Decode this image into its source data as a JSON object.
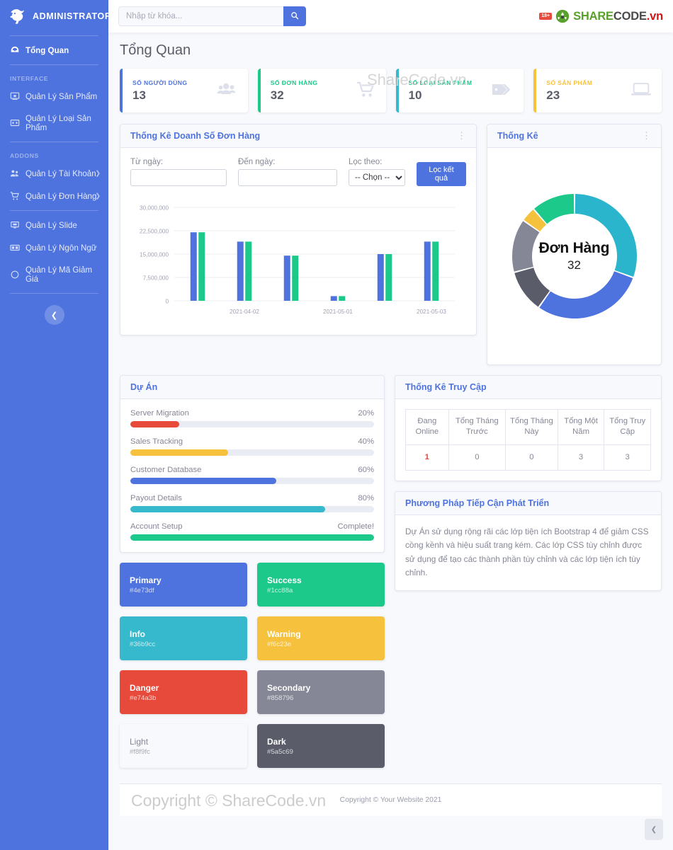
{
  "brand": {
    "title": "ADMINISTRATOR"
  },
  "sidebar": {
    "items": [
      {
        "label": "Tổng Quan",
        "icon": "dashboard-icon",
        "active": true
      }
    ],
    "sections": [
      {
        "heading": "INTERFACE",
        "items": [
          {
            "label": "Quản Lý Sản Phẩm",
            "icon": "product-icon",
            "caret": false
          },
          {
            "label": "Quản Lý Loại Sản Phẩm",
            "icon": "category-icon",
            "caret": false
          }
        ]
      },
      {
        "heading": "ADDONS",
        "items": [
          {
            "label": "Quản Lý Tài Khoản",
            "icon": "users-icon",
            "caret": true
          },
          {
            "label": "Quản Lý Đơn Hàng",
            "icon": "cart-icon",
            "caret": true
          }
        ]
      },
      {
        "heading": "",
        "items": [
          {
            "label": "Quản Lý Slide",
            "icon": "slide-icon",
            "caret": false
          },
          {
            "label": "Quản Lý Ngôn Ngữ",
            "icon": "language-icon",
            "caret": false
          },
          {
            "label": "Quản Lý Mã Giảm Giá",
            "icon": "coupon-icon",
            "caret": false
          }
        ]
      }
    ],
    "collapse_icon": "chevron-left-icon"
  },
  "topbar": {
    "search_placeholder": "Nhập từ khóa...",
    "search_value": "",
    "search_icon": "search-icon",
    "logo": {
      "badge": "18+",
      "share": "SHARE",
      "code": "CODE",
      "vn": ".vn"
    }
  },
  "page": {
    "title": "Tổng Quan"
  },
  "stats": [
    {
      "label": "SỐ NGƯỜI DÙNG",
      "value": "13",
      "accent": "#4e73df",
      "icon": "users-group-icon",
      "variant": "blue"
    },
    {
      "label": "SỐ ĐƠN HÀNG",
      "value": "32",
      "accent": "#1cc88a",
      "icon": "shopping-cart-icon",
      "variant": "green"
    },
    {
      "label": "SỐ LOẠI SẢN PHẨM",
      "value": "10",
      "accent": "#36b9cc",
      "icon": "tag-icon",
      "variant": "teal"
    },
    {
      "label": "SỐ SẢN PHẨM",
      "value": "23",
      "accent": "#f6c23e",
      "icon": "laptop-icon",
      "variant": "amber"
    }
  ],
  "sales_card": {
    "title": "Thống Kê Doanh Số Đơn Hàng",
    "kebab_icon": "vertical-dots-icon",
    "filters": {
      "from_label": "Từ ngày:",
      "from_value": "",
      "to_label": "Đến ngày:",
      "to_value": "",
      "by_label": "Lọc theo:",
      "by_selected": "-- Chọn --",
      "by_options": [
        "-- Chọn --"
      ],
      "submit_label": "Lọc kết quả"
    }
  },
  "stats_card": {
    "title": "Thống Kê",
    "kebab_icon": "vertical-dots-icon",
    "center_label": "Đơn Hàng",
    "center_value": "32"
  },
  "projects_card": {
    "title": "Dự Án",
    "items": [
      {
        "name": "Server Migration",
        "value": "20%",
        "percent": 20,
        "color": "#e74a3b"
      },
      {
        "name": "Sales Tracking",
        "value": "40%",
        "percent": 40,
        "color": "#f6c23e"
      },
      {
        "name": "Customer Database",
        "value": "60%",
        "percent": 60,
        "color": "#4e73df"
      },
      {
        "name": "Payout Details",
        "value": "80%",
        "percent": 80,
        "color": "#36b9cc"
      },
      {
        "name": "Account Setup",
        "value": "Complete!",
        "percent": 100,
        "color": "#1cc88a"
      }
    ]
  },
  "swatches": [
    {
      "name": "Primary",
      "hex": "#4e73df",
      "light": false
    },
    {
      "name": "Success",
      "hex": "#1cc88a",
      "light": false
    },
    {
      "name": "Info",
      "hex": "#36b9cc",
      "light": false
    },
    {
      "name": "Warning",
      "hex": "#f6c23e",
      "light": false
    },
    {
      "name": "Danger",
      "hex": "#e74a3b",
      "light": false
    },
    {
      "name": "Secondary",
      "hex": "#858796",
      "light": false
    },
    {
      "name": "Light",
      "hex": "#f8f9fc",
      "light": true
    },
    {
      "name": "Dark",
      "hex": "#5a5c69",
      "light": false
    }
  ],
  "visits_card": {
    "title": "Thống Kê Truy Cập",
    "headers": [
      "Đang Online",
      "Tổng Tháng Trước",
      "Tổng Tháng Này",
      "Tổng Một Năm",
      "Tổng Truy Cập"
    ],
    "values": [
      "1",
      "0",
      "0",
      "3",
      "3"
    ]
  },
  "approach_card": {
    "title": "Phương Pháp Tiếp Cận Phát Triển",
    "text": "Dự Án sử dụng rộng rãi các lớp tiện ích Bootstrap 4 để giảm CSS cồng kềnh và hiệu suất trang kém. Các lớp CSS tùy chỉnh được sử dụng để tạo các thành phần tùy chỉnh và các lớp tiện ích tùy chỉnh."
  },
  "footer": {
    "text": "Copyright © Your Website 2021",
    "scroll_top_icon": "chevron-up-icon"
  },
  "watermarks": {
    "top": "ShareCode.vn",
    "bottom": "Copyright © ShareCode.vn"
  },
  "chart_data": [
    {
      "type": "bar",
      "title": "Thống Kê Doanh Số Đơn Hàng",
      "xlabel": "",
      "ylabel": "",
      "ylim": [
        0,
        30000000
      ],
      "yticks": [
        0,
        7500000,
        15000000,
        22500000,
        30000000
      ],
      "ytick_labels": [
        "0",
        "7,500,000",
        "15,000,000",
        "22,500,000",
        "30,000,000"
      ],
      "grid": true,
      "legend": false,
      "categories": [
        "",
        "2021-04-02",
        "",
        "2021-05-01",
        "",
        "2021-05-03"
      ],
      "xtick_labels": [
        "2021-04-02",
        "2021-05-01",
        "2021-05-03"
      ],
      "series": [
        {
          "name": "Series 1",
          "color": "#4e73df",
          "values": [
            22000000,
            19000000,
            14500000,
            1500000,
            15000000,
            19000000
          ]
        },
        {
          "name": "Series 2",
          "color": "#1cc88a",
          "values": [
            22000000,
            19000000,
            14500000,
            1500000,
            15000000,
            19000000
          ]
        }
      ]
    },
    {
      "type": "pie",
      "title": "Thống Kê",
      "center_label": "Đơn Hàng",
      "center_value": "32",
      "labels": [
        "Segment 1",
        "Segment 2",
        "Segment 3",
        "Segment 4",
        "Segment 5",
        "Segment 6"
      ],
      "values": [
        110,
        105,
        40,
        50,
        14,
        41
      ],
      "colors": [
        "#2bb5cc",
        "#4e73df",
        "#5a5c69",
        "#858796",
        "#f6c23e",
        "#1cc88a"
      ],
      "legend": false
    }
  ]
}
